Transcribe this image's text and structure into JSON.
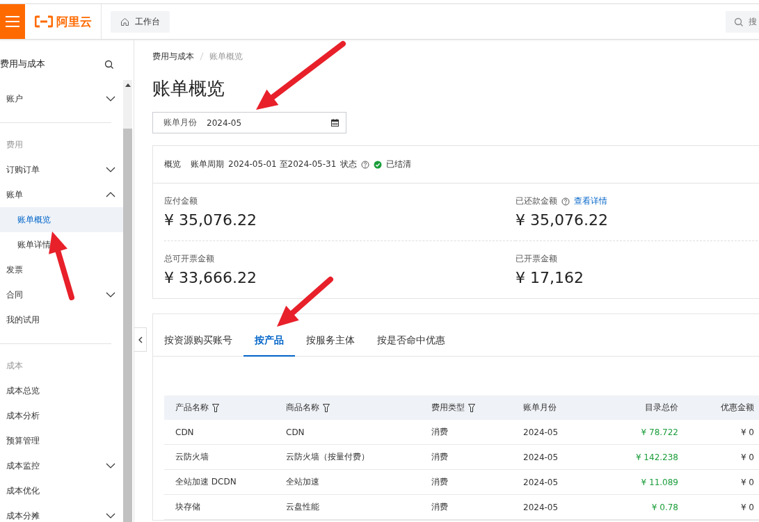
{
  "topbar": {
    "logo": "阿里云",
    "workbench": "工作台",
    "search_placeholder": "搜"
  },
  "sidebar": {
    "title": "费用与成本",
    "sections": [
      {
        "items": [
          {
            "label": "账户",
            "kind": "menu",
            "expanded": false,
            "selected": false
          }
        ]
      },
      {
        "label": "费用",
        "items": [
          {
            "label": "订购订单",
            "kind": "menu",
            "expanded": false,
            "selected": false
          },
          {
            "label": "账单",
            "kind": "menu",
            "expanded": true,
            "selected": false,
            "children": [
              {
                "label": "账单概览",
                "selected": true
              },
              {
                "label": "账单详情",
                "selected": false
              }
            ]
          },
          {
            "label": "发票",
            "kind": "link",
            "selected": false
          },
          {
            "label": "合同",
            "kind": "menu",
            "expanded": false,
            "selected": false
          },
          {
            "label": "我的试用",
            "kind": "link",
            "selected": false
          }
        ]
      },
      {
        "label": "成本",
        "items": [
          {
            "label": "成本总览",
            "kind": "link",
            "selected": false
          },
          {
            "label": "成本分析",
            "kind": "link",
            "selected": false
          },
          {
            "label": "预算管理",
            "kind": "link",
            "selected": false
          },
          {
            "label": "成本监控",
            "kind": "menu",
            "expanded": false,
            "selected": false
          },
          {
            "label": "成本优化",
            "kind": "link",
            "selected": false
          },
          {
            "label": "成本分摊",
            "kind": "menu",
            "expanded": false,
            "selected": false
          }
        ]
      }
    ]
  },
  "breadcrumb": [
    "费用与成本",
    "账单概览"
  ],
  "page_title": "账单概览",
  "month_picker": {
    "label": "账单月份",
    "value": "2024-05"
  },
  "overview": {
    "title": "概览",
    "period_label": "账单周期",
    "period": "2024-05-01 至2024-05-31",
    "status_label": "状态",
    "status": "已结清",
    "stats": [
      {
        "label": "应付金额",
        "value": "¥ 35,076.22",
        "help": false
      },
      {
        "label": "已还款金额",
        "value": "¥ 35,076.22",
        "help": true,
        "link": "查看详情"
      },
      {
        "label": "总可开票金额",
        "value": "¥ 33,666.22",
        "help": false
      },
      {
        "label": "已开票金额",
        "value": "¥ 17,162",
        "help": false
      }
    ]
  },
  "tabs": [
    {
      "label": "按资源购买账号",
      "selected": false
    },
    {
      "label": "按产品",
      "selected": true
    },
    {
      "label": "按服务主体",
      "selected": false
    },
    {
      "label": "按是否命中优惠",
      "selected": false
    }
  ],
  "table": {
    "columns": [
      {
        "label": "产品名称",
        "filter": true,
        "kind": "text"
      },
      {
        "label": "商品名称",
        "filter": true,
        "kind": "text"
      },
      {
        "label": "费用类型",
        "filter": true,
        "kind": "text"
      },
      {
        "label": "账单月份",
        "filter": false,
        "kind": "text"
      },
      {
        "label": "目录总价",
        "filter": false,
        "kind": "price"
      },
      {
        "label": "优惠金额",
        "filter": false,
        "kind": "amount"
      }
    ],
    "rows": [
      [
        "CDN",
        "CDN",
        "消费",
        "2024-05",
        "¥ 78.722",
        "¥ 0"
      ],
      [
        "云防火墙",
        "云防火墙（按量付费）",
        "消费",
        "2024-05",
        "¥ 142.238",
        "¥ 0"
      ],
      [
        "全站加速 DCDN",
        "全站加速",
        "消费",
        "2024-05",
        "¥ 11.089",
        "¥ 0"
      ],
      [
        "块存储",
        "云盘性能",
        "消费",
        "2024-05",
        "¥ 0.78",
        "¥ 0"
      ]
    ]
  }
}
